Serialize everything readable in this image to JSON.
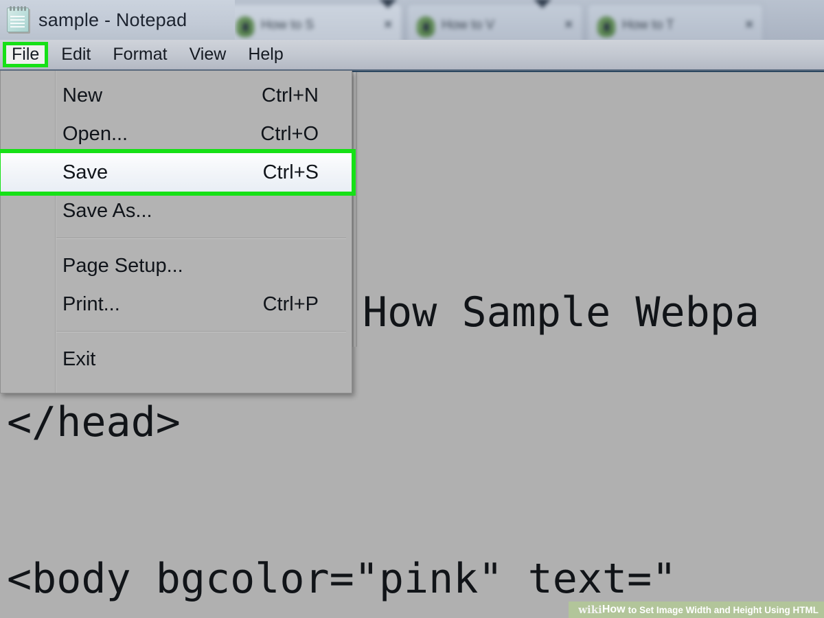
{
  "background_browser": {
    "tabs": [
      {
        "title": "How to S",
        "favicon": "globe-icon",
        "close": "×"
      },
      {
        "title": "How to V",
        "favicon": "globe-icon",
        "close": "×"
      },
      {
        "title": "How to T",
        "favicon": "globe-icon",
        "close": "×"
      }
    ]
  },
  "notepad": {
    "title": "sample - Notepad",
    "icon": "notepad-icon",
    "menubar": [
      {
        "label": "File",
        "open": true
      },
      {
        "label": "Edit",
        "open": false
      },
      {
        "label": "Format",
        "open": false
      },
      {
        "label": "View",
        "open": false
      },
      {
        "label": "Help",
        "open": false
      }
    ],
    "file_menu": {
      "items": [
        {
          "label": "New",
          "accelerator": "Ctrl+N",
          "highlighted": false
        },
        {
          "label": "Open...",
          "accelerator": "Ctrl+O",
          "highlighted": false
        },
        {
          "label": "Save",
          "accelerator": "Ctrl+S",
          "highlighted": true
        },
        {
          "label": "Save As...",
          "accelerator": "",
          "highlighted": false
        },
        {
          "label": "Page Setup...",
          "accelerator": "",
          "highlighted": false
        },
        {
          "label": "Print...",
          "accelerator": "Ctrl+P",
          "highlighted": false
        },
        {
          "label": "Exit",
          "accelerator": "",
          "highlighted": false
        }
      ]
    },
    "document_text": {
      "line_title": "How Sample Webpa",
      "line_head_close": "</head>",
      "line_body": "<body bgcolor=\"pink\" text=\""
    }
  },
  "highlight_color": "#16e016",
  "watermark": {
    "wiki": "wiki",
    "how": "How",
    "rest": "to Set Image Width and Height Using HTML"
  }
}
